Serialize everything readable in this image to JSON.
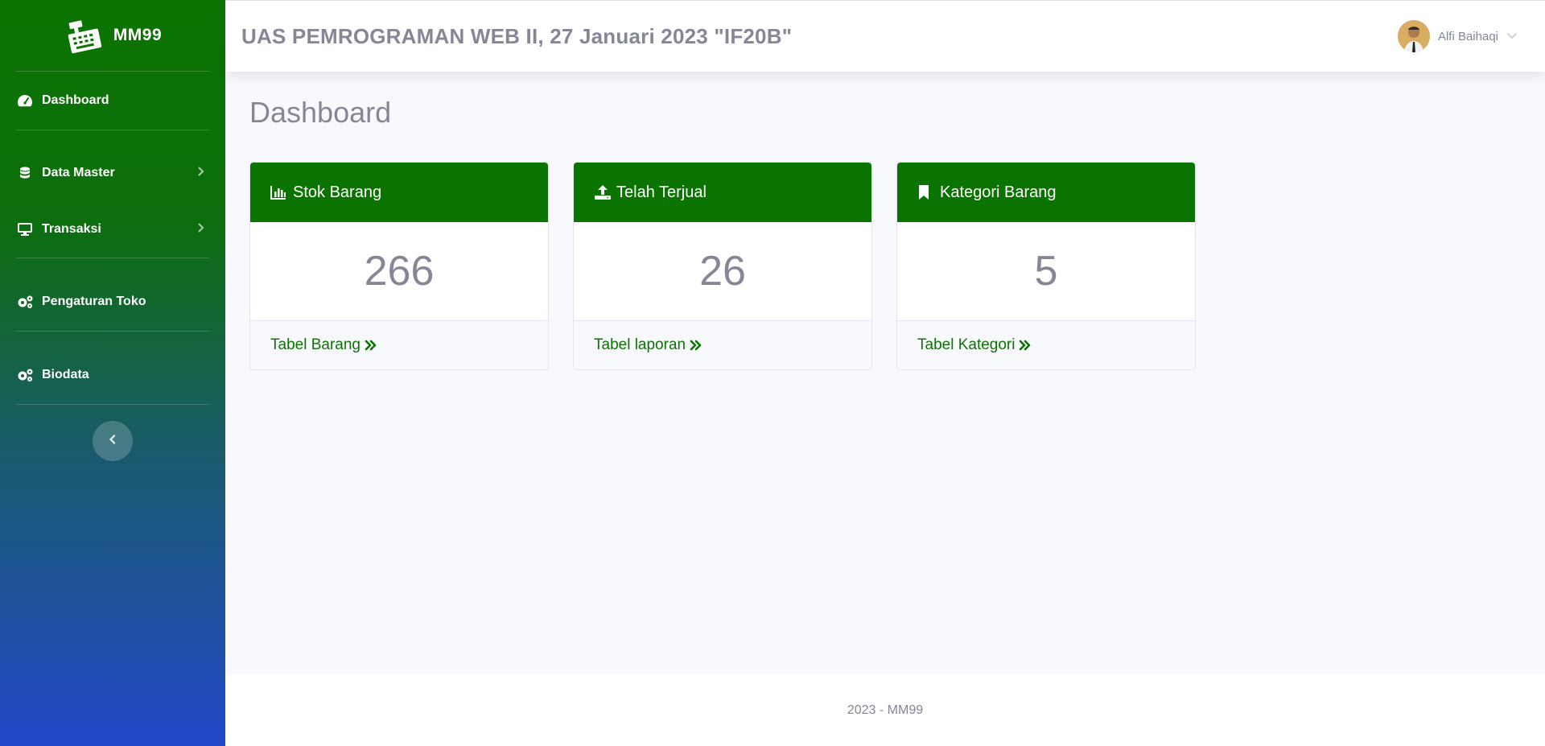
{
  "sidebar": {
    "brand": "MM99",
    "items": [
      {
        "label": "Dashboard",
        "icon": "tachometer-icon"
      },
      {
        "label": "Data Master",
        "icon": "database-icon",
        "has_submenu": true
      },
      {
        "label": "Transaksi",
        "icon": "desktop-icon",
        "has_submenu": true
      },
      {
        "label": "Pengaturan Toko",
        "icon": "cogs-icon"
      },
      {
        "label": "Biodata",
        "icon": "cogs-icon"
      }
    ]
  },
  "topbar": {
    "title": "UAS PEMROGRAMAN WEB II, 27 Januari 2023 \"IF20B\"",
    "user_name": "Alfi Baihaqi"
  },
  "main": {
    "page_title": "Dashboard",
    "cards": [
      {
        "header": "Stok Barang",
        "icon": "chart-bar-icon",
        "value": "266",
        "footer": "Tabel Barang"
      },
      {
        "header": "Telah Terjual",
        "icon": "upload-icon",
        "value": "26",
        "footer": "Tabel laporan"
      },
      {
        "header": "Kategori Barang",
        "icon": "bookmark-icon",
        "value": "5",
        "footer": "Tabel Kategori"
      }
    ]
  },
  "footer": {
    "text": "2023 - MM99"
  },
  "colors": {
    "primary_green": "#0b7400",
    "sidebar_bottom": "#2147c8",
    "text_gray": "#858796"
  }
}
